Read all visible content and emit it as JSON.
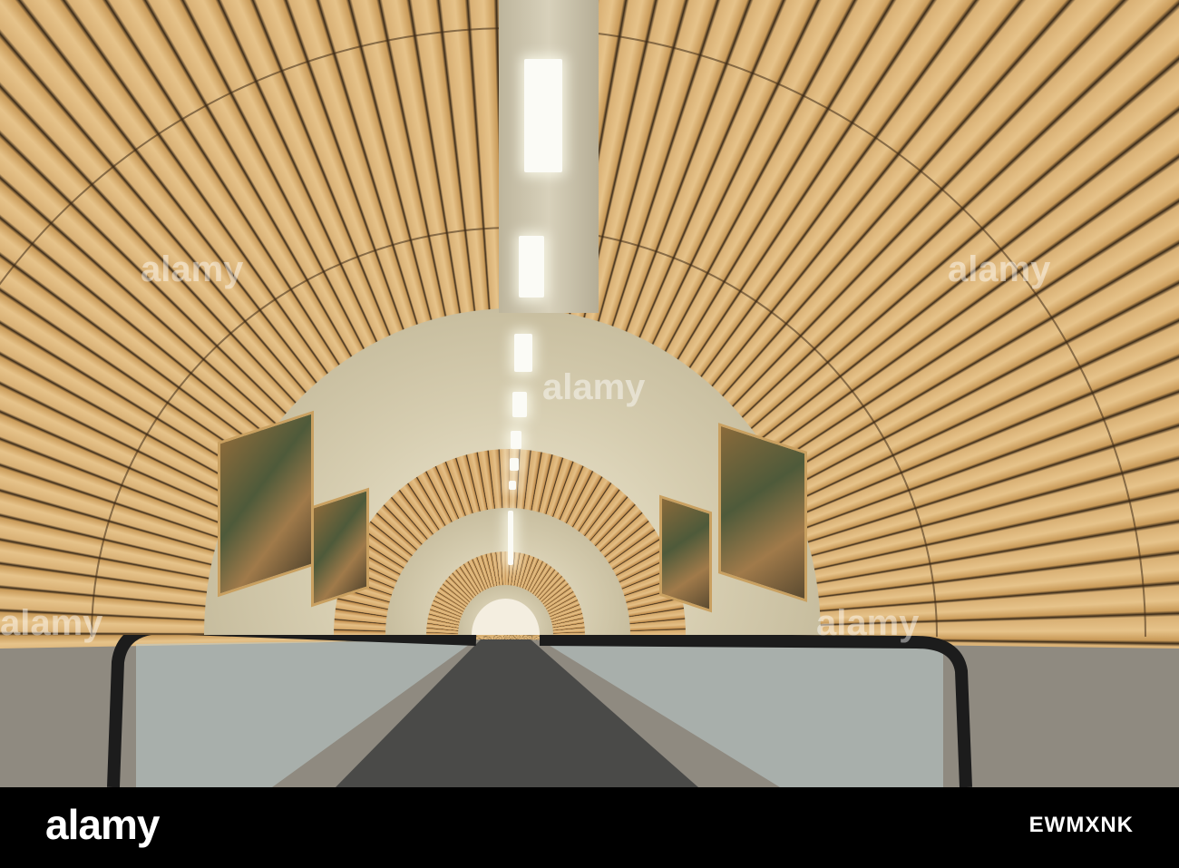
{
  "watermark": "alamy",
  "footer": {
    "logo": "alamy",
    "image_id": "EWMXNK"
  },
  "colors": {
    "wood": "#d9b074",
    "concrete": "#d6cdb0",
    "footer_bg": "#000000"
  }
}
